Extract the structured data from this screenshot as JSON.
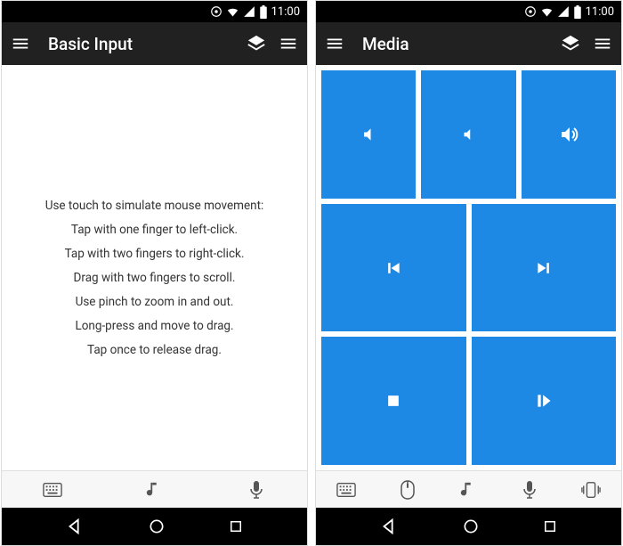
{
  "status": {
    "time": "11:00"
  },
  "left": {
    "title": "Basic Input",
    "instructions": [
      "Use touch to simulate mouse movement:",
      "Tap with one finger to left-click.",
      "Tap with two fingers to right-click.",
      "Drag with two fingers to scroll.",
      "Use pinch to zoom in and out.",
      "Long-press and move to drag.",
      "Tap once to release drag."
    ]
  },
  "right": {
    "title": "Media"
  },
  "colors": {
    "tile": "#1e88e5",
    "appbar": "#212121"
  }
}
